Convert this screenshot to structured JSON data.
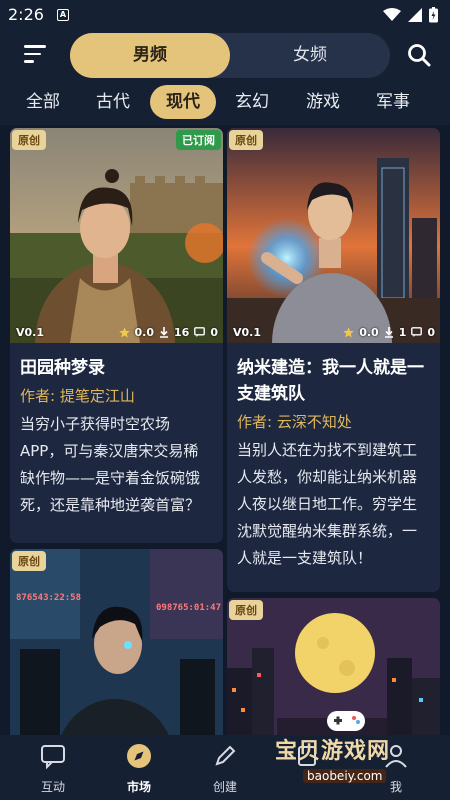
{
  "status": {
    "time": "2:26",
    "a_icon": "A"
  },
  "header": {
    "tab_male": "男频",
    "tab_female": "女频"
  },
  "categories": [
    "全部",
    "古代",
    "现代",
    "玄幻",
    "游戏",
    "军事"
  ],
  "cards": [
    {
      "badge": "原创",
      "subscribed": "已订阅",
      "version": "V0.1",
      "rating": "0.0",
      "downloads": "16",
      "comments": "0",
      "title": "田园种梦录",
      "author": "作者: 提笔定江山",
      "desc": "当穷小子获得时空农场APP，可与秦汉唐宋交易稀缺作物——是守着金饭碗饿死，还是靠种地逆袭首富？"
    },
    {
      "badge": "原创",
      "version": "V0.1",
      "rating": "0.0",
      "downloads": "1",
      "comments": "0",
      "title": "纳米建造：我一人就是一支建筑队",
      "author": "作者: 云深不知处",
      "desc": "当别人还在为找不到建筑工人发愁，你却能让纳米机器人夜以继日地工作。穷学生沈默觉醒纳米集群系统，一人就是一支建筑队！"
    },
    {
      "badge": "原创",
      "screen_left": "876543:22:58",
      "screen_right": "098765:01:47"
    },
    {
      "badge": "原创"
    }
  ],
  "nav": [
    {
      "label": "互动",
      "icon": "chat-icon"
    },
    {
      "label": "市场",
      "icon": "compass-icon"
    },
    {
      "label": "创建",
      "icon": "pencil-icon"
    },
    {
      "label": "",
      "icon": "list-icon"
    },
    {
      "label": "我",
      "icon": "person-icon"
    }
  ],
  "watermark": {
    "big": "宝贝游戏网",
    "small": "baobeiy.com"
  },
  "colors": {
    "accent": "#e4c47a",
    "bg": "#111a2a",
    "card": "#1d2840",
    "author": "#e0b65a",
    "subscribed": "#2f9a49"
  }
}
